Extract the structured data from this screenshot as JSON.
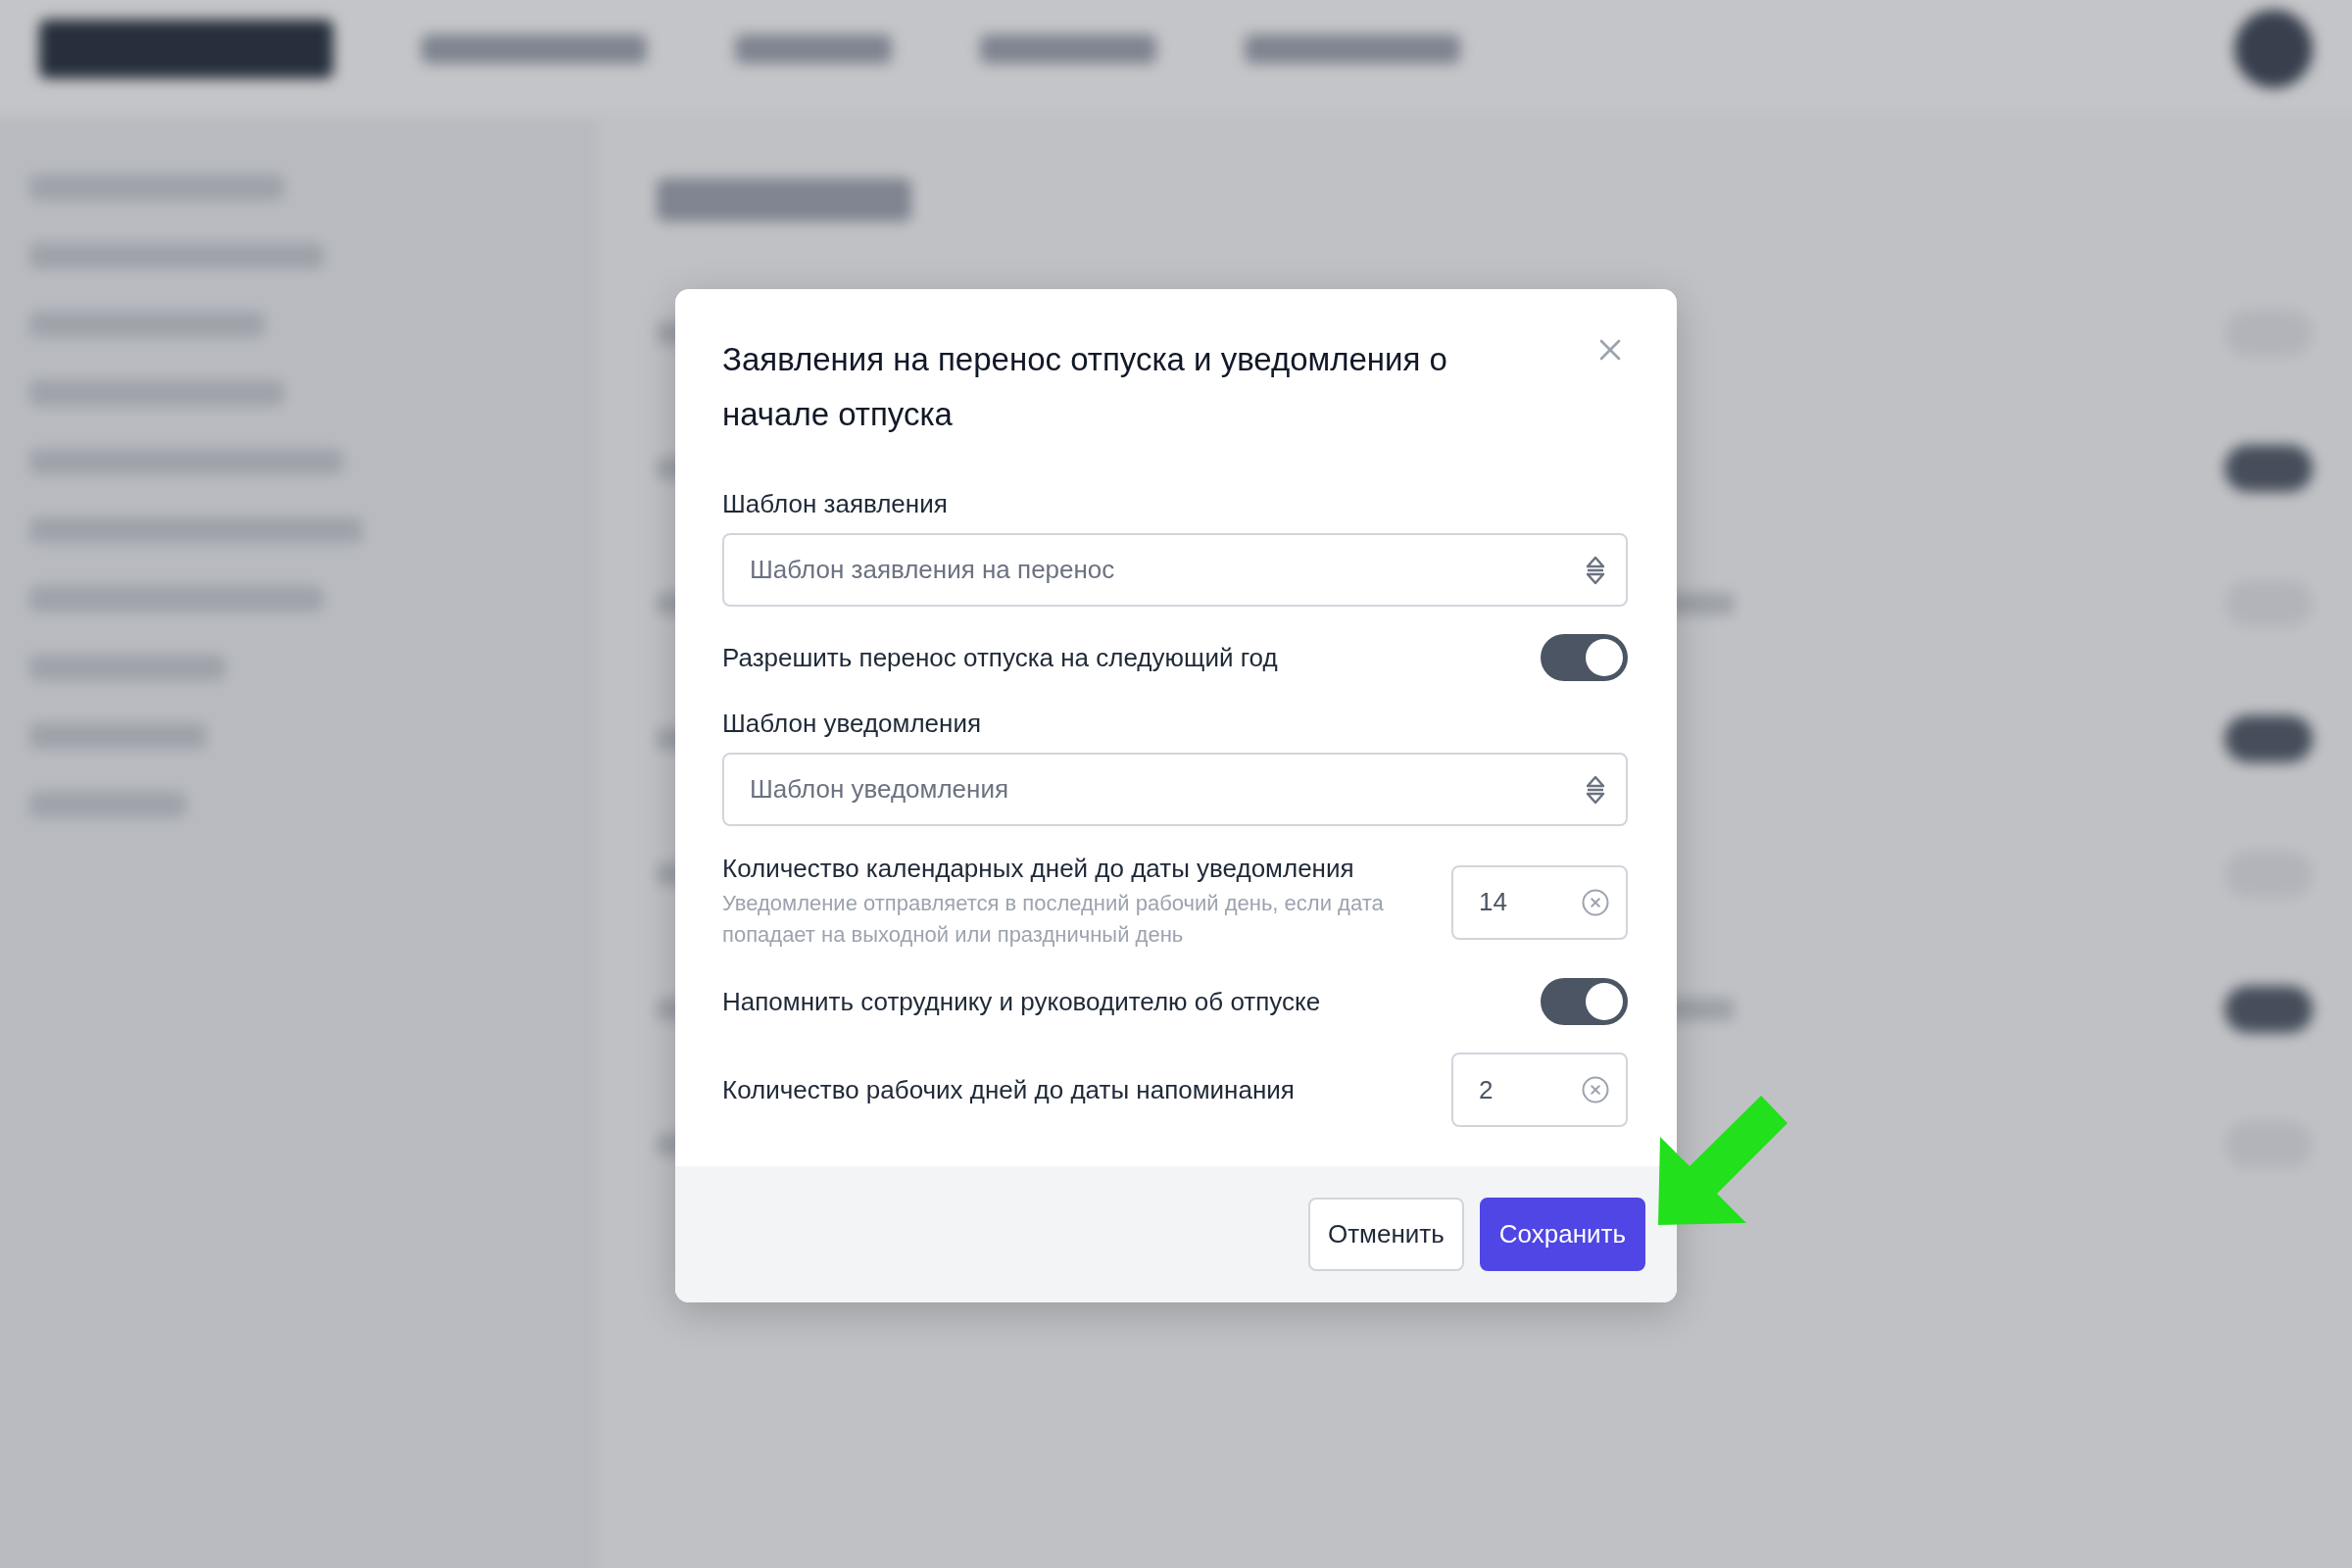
{
  "dialog": {
    "title": "Заявления на перенос отпуска и уведомления о начале отпуска",
    "fields": [
      {
        "kind": "select",
        "label": "Шаблон заявления",
        "value": "Шаблон заявления на перенос"
      },
      {
        "kind": "toggle",
        "label": "Разрешить перенос отпуска на следующий год",
        "on": true
      },
      {
        "kind": "select",
        "label": "Шаблон уведомления",
        "value": "Шаблон уведомления"
      },
      {
        "kind": "number",
        "label": "Количество календарных дней до даты уведомления",
        "hint": "Уведомление отправляется в последний рабочий день, если дата попадает на выходной или праздничный день",
        "value": "14"
      },
      {
        "kind": "toggle",
        "label": "Напомнить сотруднику и руководителю об отпуске",
        "on": true
      },
      {
        "kind": "number",
        "label": "Количество рабочих дней до даты напоминания",
        "value": "2"
      }
    ],
    "buttons": [
      {
        "label": "Отменить",
        "kind": "secondary"
      },
      {
        "label": "Сохранить",
        "kind": "primary"
      }
    ]
  }
}
